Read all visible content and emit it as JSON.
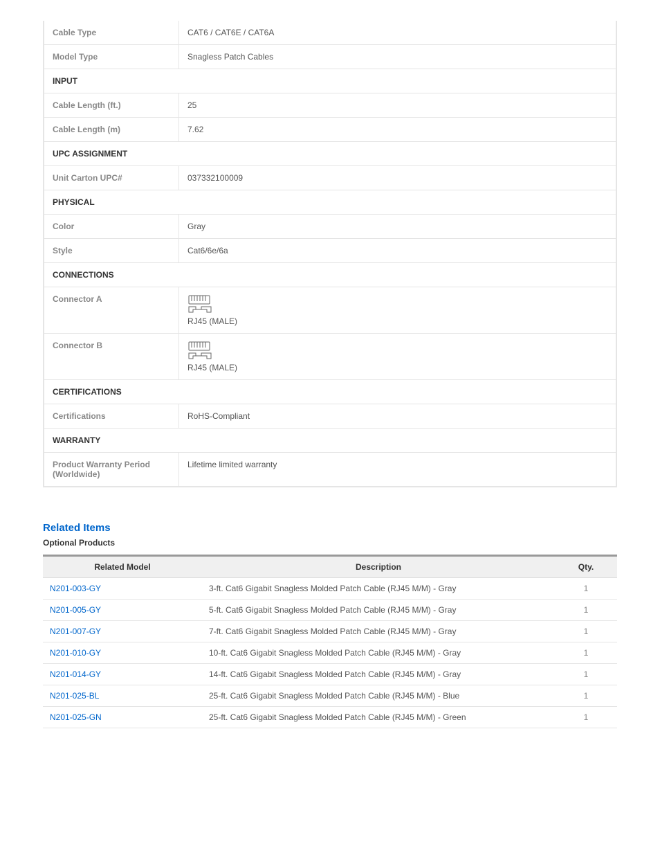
{
  "specs": {
    "cable_type_label": "Cable Type",
    "cable_type_value": "CAT6 / CAT6E / CAT6A",
    "model_type_label": "Model Type",
    "model_type_value": "Snagless Patch Cables",
    "section_input": "INPUT",
    "cable_length_ft_label": "Cable Length (ft.)",
    "cable_length_ft_value": "25",
    "cable_length_m_label": "Cable Length (m)",
    "cable_length_m_value": "7.62",
    "section_upc": "UPC ASSIGNMENT",
    "unit_upc_label": "Unit Carton UPC#",
    "unit_upc_value": "037332100009",
    "section_physical": "PHYSICAL",
    "color_label": "Color",
    "color_value": "Gray",
    "style_label": "Style",
    "style_value": "Cat6/6e/6a",
    "section_connections": "CONNECTIONS",
    "connector_a_label": "Connector A",
    "connector_a_value": "RJ45 (MALE)",
    "connector_b_label": "Connector B",
    "connector_b_value": "RJ45 (MALE)",
    "section_certifications": "CERTIFICATIONS",
    "certifications_label": "Certifications",
    "certifications_value": "RoHS-Compliant",
    "section_warranty": "WARRANTY",
    "warranty_label": "Product Warranty Period (Worldwide)",
    "warranty_value": "Lifetime limited warranty"
  },
  "related": {
    "heading": "Related Items",
    "subheading": "Optional Products",
    "col_model": "Related Model",
    "col_desc": "Description",
    "col_qty": "Qty.",
    "items": [
      {
        "model": "N201-003-GY",
        "desc": "3-ft. Cat6 Gigabit Snagless Molded Patch Cable (RJ45 M/M) - Gray",
        "qty": "1"
      },
      {
        "model": "N201-005-GY",
        "desc": "5-ft. Cat6 Gigabit Snagless Molded Patch Cable (RJ45 M/M) - Gray",
        "qty": "1"
      },
      {
        "model": "N201-007-GY",
        "desc": "7-ft. Cat6 Gigabit Snagless Molded Patch Cable (RJ45 M/M) - Gray",
        "qty": "1"
      },
      {
        "model": "N201-010-GY",
        "desc": "10-ft. Cat6 Gigabit Snagless Molded Patch Cable (RJ45 M/M) - Gray",
        "qty": "1"
      },
      {
        "model": "N201-014-GY",
        "desc": "14-ft. Cat6 Gigabit Snagless Molded Patch Cable (RJ45 M/M) - Gray",
        "qty": "1"
      },
      {
        "model": "N201-025-BL",
        "desc": "25-ft. Cat6 Gigabit Snagless Molded Patch Cable (RJ45 M/M) - Blue",
        "qty": "1"
      },
      {
        "model": "N201-025-GN",
        "desc": "25-ft. Cat6 Gigabit Snagless Molded Patch Cable (RJ45 M/M) - Green",
        "qty": "1"
      }
    ]
  }
}
